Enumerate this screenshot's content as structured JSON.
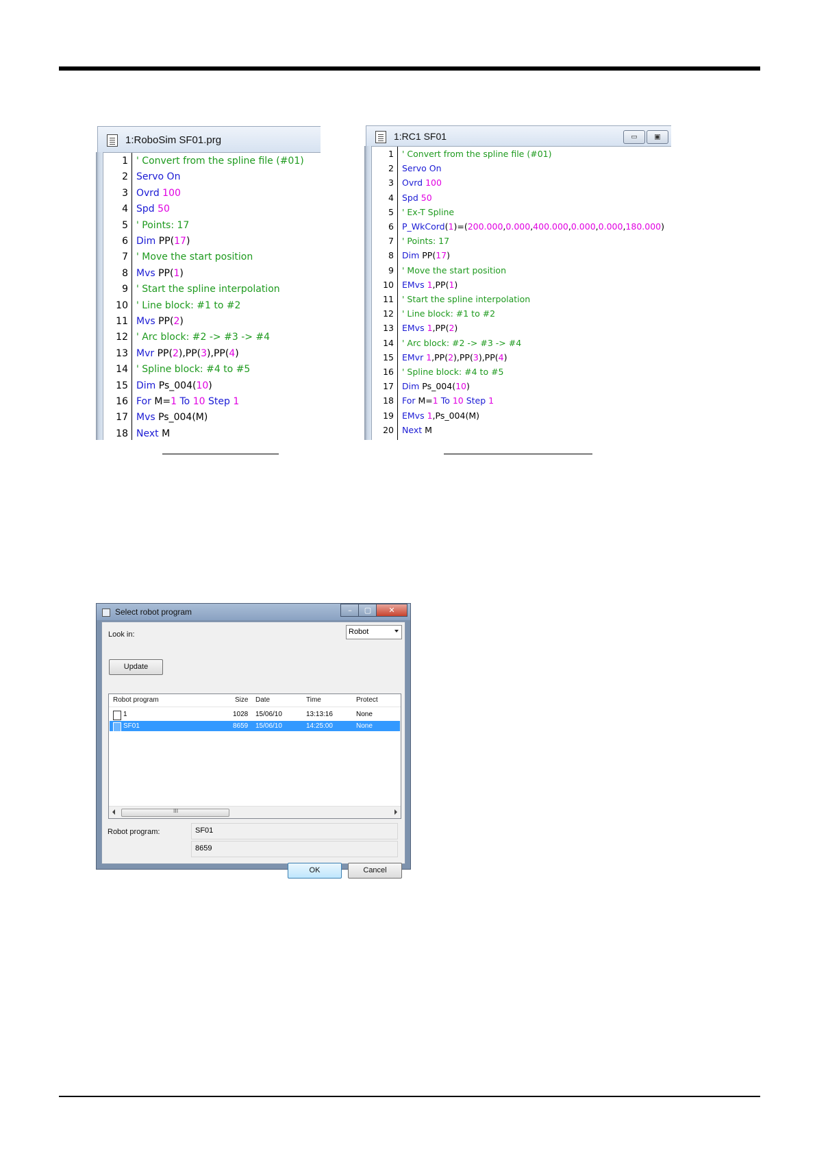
{
  "left_editor": {
    "title": "1:RoboSim SF01.prg",
    "lines": [
      {
        "n": "1",
        "t": [
          [
            "cmt",
            "' Convert from the spline file (#01)"
          ]
        ]
      },
      {
        "n": "2",
        "t": [
          [
            "kw",
            "Servo On"
          ]
        ]
      },
      {
        "n": "3",
        "t": [
          [
            "kw",
            "Ovrd "
          ],
          [
            "num",
            "100"
          ]
        ]
      },
      {
        "n": "4",
        "t": [
          [
            "kw",
            "Spd "
          ],
          [
            "num",
            "50"
          ]
        ]
      },
      {
        "n": "5",
        "t": [
          [
            "cmt",
            "' Points: 17"
          ]
        ]
      },
      {
        "n": "6",
        "t": [
          [
            "kw",
            "Dim "
          ],
          [
            "txt",
            "PP("
          ],
          [
            "num",
            "17"
          ],
          [
            "txt",
            ")"
          ]
        ]
      },
      {
        "n": "7",
        "t": [
          [
            "cmt",
            "' Move the start position"
          ]
        ]
      },
      {
        "n": "8",
        "t": [
          [
            "kw",
            "Mvs "
          ],
          [
            "txt",
            "PP("
          ],
          [
            "num",
            "1"
          ],
          [
            "txt",
            ")"
          ]
        ]
      },
      {
        "n": "9",
        "t": [
          [
            "cmt",
            "' Start the spline interpolation"
          ]
        ]
      },
      {
        "n": "10",
        "t": [
          [
            "cmt",
            "' Line block: #1 to #2"
          ]
        ]
      },
      {
        "n": "11",
        "t": [
          [
            "kw",
            "Mvs "
          ],
          [
            "txt",
            "PP("
          ],
          [
            "num",
            "2"
          ],
          [
            "txt",
            ")"
          ]
        ]
      },
      {
        "n": "12",
        "t": [
          [
            "cmt",
            "' Arc block: #2 -> #3 -> #4"
          ]
        ]
      },
      {
        "n": "13",
        "t": [
          [
            "kw",
            "Mvr "
          ],
          [
            "txt",
            "PP("
          ],
          [
            "num",
            "2"
          ],
          [
            "txt",
            "),PP("
          ],
          [
            "num",
            "3"
          ],
          [
            "txt",
            "),PP("
          ],
          [
            "num",
            "4"
          ],
          [
            "txt",
            ")"
          ]
        ]
      },
      {
        "n": "14",
        "t": [
          [
            "cmt",
            "' Spline block: #4 to #5"
          ]
        ]
      },
      {
        "n": "15",
        "t": [
          [
            "kw",
            "Dim "
          ],
          [
            "txt",
            "Ps_004("
          ],
          [
            "num",
            "10"
          ],
          [
            "txt",
            ")"
          ]
        ]
      },
      {
        "n": "16",
        "t": [
          [
            "kw",
            "For "
          ],
          [
            "txt",
            "M="
          ],
          [
            "num",
            "1"
          ],
          [
            "kw",
            " To "
          ],
          [
            "num",
            "10"
          ],
          [
            "kw",
            " Step "
          ],
          [
            "num",
            "1"
          ]
        ]
      },
      {
        "n": "17",
        "t": [
          [
            "kw",
            "Mvs "
          ],
          [
            "txt",
            "Ps_004(M)"
          ]
        ]
      },
      {
        "n": "18",
        "t": [
          [
            "kw",
            "Next "
          ],
          [
            "txt",
            "M"
          ]
        ]
      }
    ]
  },
  "right_editor": {
    "title": "1:RC1 SF01",
    "btn_minimize": "▭",
    "btn_maximize": "▣",
    "lines": [
      {
        "n": "1",
        "t": [
          [
            "cmt",
            "' Convert from the spline file (#01)"
          ]
        ]
      },
      {
        "n": "2",
        "t": [
          [
            "kw",
            "Servo On"
          ]
        ]
      },
      {
        "n": "3",
        "t": [
          [
            "kw",
            "Ovrd "
          ],
          [
            "num",
            "100"
          ]
        ]
      },
      {
        "n": "4",
        "t": [
          [
            "kw",
            "Spd "
          ],
          [
            "num",
            "50"
          ]
        ]
      },
      {
        "n": "5",
        "t": [
          [
            "cmt",
            "' Ex-T Spline"
          ]
        ]
      },
      {
        "n": "6",
        "t": [
          [
            "kw",
            "P_WkCord"
          ],
          [
            "txt",
            "("
          ],
          [
            "num",
            "1"
          ],
          [
            "txt",
            ")=("
          ],
          [
            "num",
            "200.000"
          ],
          [
            "txt",
            ","
          ],
          [
            "num",
            "0.000"
          ],
          [
            "txt",
            ","
          ],
          [
            "num",
            "400.000"
          ],
          [
            "txt",
            ","
          ],
          [
            "num",
            "0.000"
          ],
          [
            "txt",
            ","
          ],
          [
            "num",
            "0.000"
          ],
          [
            "txt",
            ","
          ],
          [
            "num",
            "180.000"
          ],
          [
            "txt",
            ")"
          ]
        ]
      },
      {
        "n": "7",
        "t": [
          [
            "cmt",
            "' Points: 17"
          ]
        ]
      },
      {
        "n": "8",
        "t": [
          [
            "kw",
            "Dim "
          ],
          [
            "txt",
            "PP("
          ],
          [
            "num",
            "17"
          ],
          [
            "txt",
            ")"
          ]
        ]
      },
      {
        "n": "9",
        "t": [
          [
            "cmt",
            "' Move the start position"
          ]
        ]
      },
      {
        "n": "10",
        "t": [
          [
            "kw",
            "EMvs "
          ],
          [
            "num",
            "1"
          ],
          [
            "txt",
            ",PP("
          ],
          [
            "num",
            "1"
          ],
          [
            "txt",
            ")"
          ]
        ]
      },
      {
        "n": "11",
        "t": [
          [
            "cmt",
            "' Start the spline interpolation"
          ]
        ]
      },
      {
        "n": "12",
        "t": [
          [
            "cmt",
            "' Line block: #1 to #2"
          ]
        ]
      },
      {
        "n": "13",
        "t": [
          [
            "kw",
            "EMvs "
          ],
          [
            "num",
            "1"
          ],
          [
            "txt",
            ",PP("
          ],
          [
            "num",
            "2"
          ],
          [
            "txt",
            ")"
          ]
        ]
      },
      {
        "n": "14",
        "t": [
          [
            "cmt",
            "' Arc block: #2 -> #3 -> #4"
          ]
        ]
      },
      {
        "n": "15",
        "t": [
          [
            "kw",
            "EMvr "
          ],
          [
            "num",
            "1"
          ],
          [
            "txt",
            ",PP("
          ],
          [
            "num",
            "2"
          ],
          [
            "txt",
            "),PP("
          ],
          [
            "num",
            "3"
          ],
          [
            "txt",
            "),PP("
          ],
          [
            "num",
            "4"
          ],
          [
            "txt",
            ")"
          ]
        ]
      },
      {
        "n": "16",
        "t": [
          [
            "cmt",
            "' Spline block: #4 to #5"
          ]
        ]
      },
      {
        "n": "17",
        "t": [
          [
            "kw",
            "Dim "
          ],
          [
            "txt",
            "Ps_004("
          ],
          [
            "num",
            "10"
          ],
          [
            "txt",
            ")"
          ]
        ]
      },
      {
        "n": "18",
        "t": [
          [
            "kw",
            "For "
          ],
          [
            "txt",
            "M="
          ],
          [
            "num",
            "1"
          ],
          [
            "kw",
            " To "
          ],
          [
            "num",
            "10"
          ],
          [
            "kw",
            " Step "
          ],
          [
            "num",
            "1"
          ]
        ]
      },
      {
        "n": "19",
        "t": [
          [
            "kw",
            "EMvs "
          ],
          [
            "num",
            "1"
          ],
          [
            "txt",
            ",Ps_004(M)"
          ]
        ]
      },
      {
        "n": "20",
        "t": [
          [
            "kw",
            "Next "
          ],
          [
            "txt",
            "M"
          ]
        ]
      }
    ]
  },
  "dialog": {
    "title": "Select robot program",
    "btn_minimize": "–",
    "btn_maximize": "▢",
    "btn_close": "✕",
    "look_in_label": "Look in:",
    "look_in_value": "Robot",
    "update_button": "Update",
    "columns": [
      "Robot program",
      "Size",
      "Date",
      "Time",
      "Protect"
    ],
    "rows": [
      {
        "name": "1",
        "size": "1028",
        "date": "15/06/10",
        "time": "13:13:16",
        "protect": "None",
        "selected": false
      },
      {
        "name": "SF01",
        "size": "8659",
        "date": "15/06/10",
        "time": "14:25:00",
        "protect": "None",
        "selected": true
      }
    ],
    "scroll_grip": "III",
    "robot_program_label": "Robot program:",
    "robot_program_value": "SF01",
    "size_value": "8659",
    "ok_button": "OK",
    "cancel_button": "Cancel"
  },
  "colors": {
    "comment": "#1e9a1e",
    "keyword": "#1a1ad4",
    "number": "#e100e1",
    "selection": "#3399ff"
  }
}
